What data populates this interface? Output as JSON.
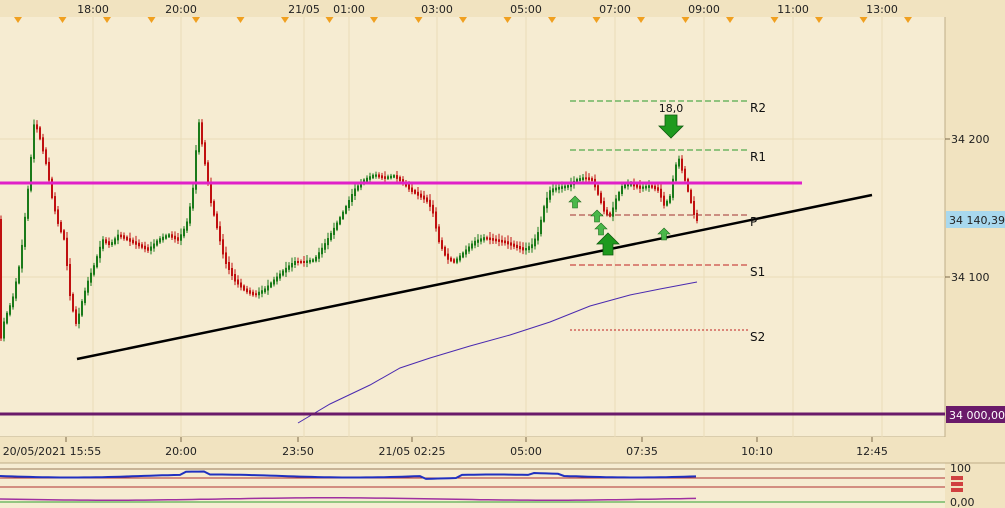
{
  "chart_data": {
    "type": "candlestick",
    "top_time_labels": [
      "18:00",
      "20:00",
      "21/05",
      "01:00",
      "03:00",
      "05:00",
      "07:00",
      "09:00",
      "11:00",
      "13:00"
    ],
    "bottom_time_labels": [
      "20/05/2021 15:55",
      "20:00",
      "23:50",
      "21/05 02:25",
      "05:00",
      "07:35",
      "10:10",
      "12:45"
    ],
    "y_ticks": [
      "34 200",
      "34 100"
    ],
    "current_price_label": "34 140,39",
    "horizontal_level_label": "34 000,00",
    "levels": [
      {
        "name": "R2",
        "value": 34250
      },
      {
        "name": "R1",
        "value": 34210
      },
      {
        "name": "P",
        "value": 34140
      },
      {
        "name": "S1",
        "value": 34108
      },
      {
        "name": "S2",
        "value": 34052
      }
    ],
    "annotation": "18,0",
    "indicator_labels": [
      "100",
      "0,00"
    ],
    "colors": {
      "up": "#1a7a1a",
      "down": "#c01010",
      "magenta_line": "#e020c8",
      "trend_line": "#000000",
      "moving_average": "#4a2ab0",
      "price_label_bg": "#a8d8ee",
      "level_label_bg": "#6a1a6a",
      "arrow": "#1e9a1e"
    }
  }
}
